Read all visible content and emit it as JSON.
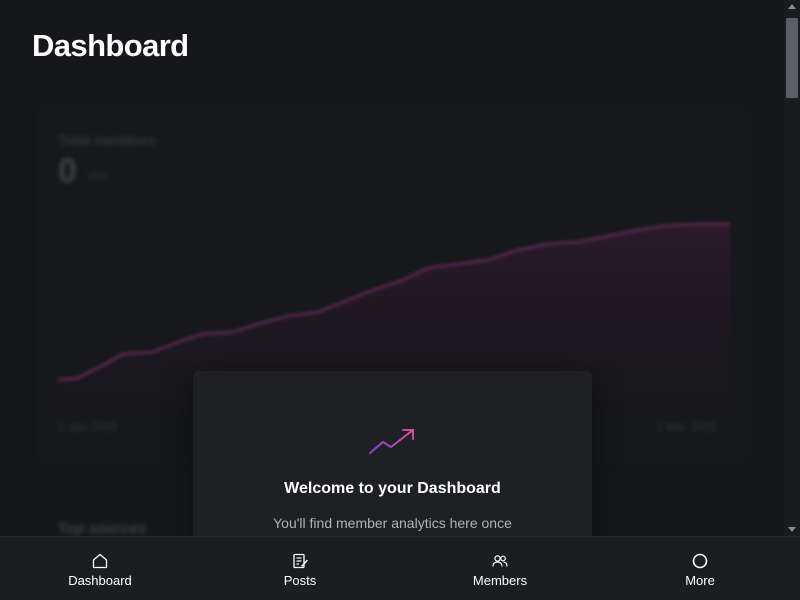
{
  "page": {
    "title": "Dashboard"
  },
  "background_stats": {
    "total_members_label": "Total members",
    "total_members_value": "0",
    "change": "0%",
    "date_start": "1 Jan 2025",
    "date_end": "1 Mar 2025",
    "top_sources_label": "Top sources"
  },
  "welcome": {
    "title": "Welcome to your Dashboard",
    "text": "You'll find member analytics here once"
  },
  "nav": {
    "items": [
      {
        "label": "Dashboard",
        "icon": "home-icon"
      },
      {
        "label": "Posts",
        "icon": "posts-icon"
      },
      {
        "label": "Members",
        "icon": "members-icon"
      },
      {
        "label": "More",
        "icon": "circle-icon"
      }
    ]
  },
  "colors": {
    "background": "#15171a",
    "accent_start": "#6c3bd9",
    "accent_end": "#e03c8a",
    "nav_background": "#1b1d20"
  }
}
